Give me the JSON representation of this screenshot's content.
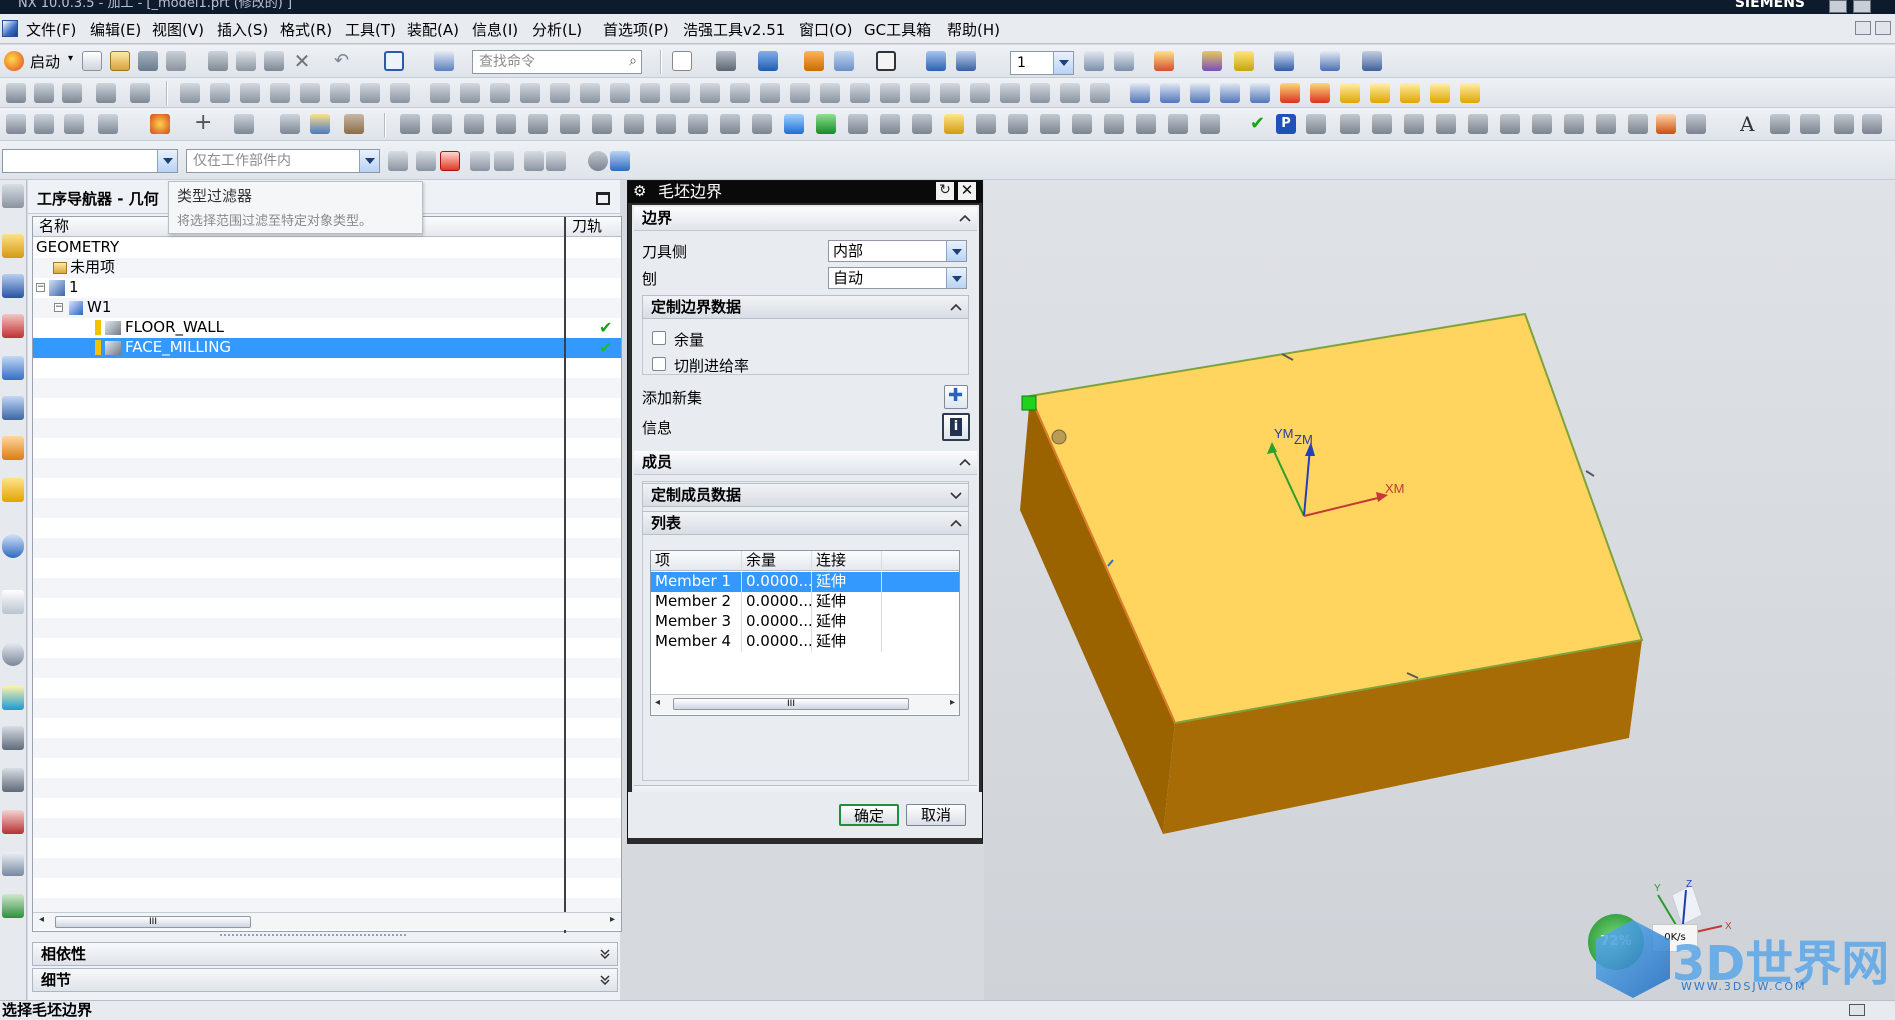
{
  "window": {
    "title": "NX 10.0.3.5 - 加工 - [_model1.prt  (修改的) ]",
    "brand": "SIEMENS"
  },
  "menu": [
    "文件(F)",
    "编辑(E)",
    "视图(V)",
    "插入(S)",
    "格式(R)",
    "工具(T)",
    "装配(A)",
    "信息(I)",
    "分析(L)",
    "首选项(P)",
    "浩强工具v2.51",
    "窗口(O)",
    "GC工具箱",
    "帮助(H)"
  ],
  "toolbar": {
    "start_label": "启动",
    "search_placeholder": "查找命令",
    "layer_value": "1",
    "filter_placeholder": "仅在工作部件内"
  },
  "tooltip": {
    "title": "类型过滤器",
    "text": "将选择范围过滤至特定对象类型。"
  },
  "navigator": {
    "title": "工序导航器 - 几何",
    "columns": {
      "name": "名称",
      "path": "刀轨"
    },
    "rows": [
      {
        "label": "GEOMETRY"
      },
      {
        "label": "未用项"
      },
      {
        "label": "1"
      },
      {
        "label": "W1"
      },
      {
        "label": "FLOOR_WALL",
        "status": "✔"
      },
      {
        "label": "FACE_MILLING",
        "status": "✔"
      }
    ],
    "scroll_thumb": "III",
    "panels": {
      "dependencies": "相依性",
      "details": "细节"
    }
  },
  "dialog": {
    "title": "毛坯边界",
    "boundary": {
      "header": "边界",
      "tool_side_label": "刀具侧",
      "tool_side_value": "内部",
      "plane_label": "刨",
      "plane_value": "自动"
    },
    "custom_boundary": {
      "header": "定制边界数据",
      "stock_label": "余量",
      "feed_label": "切削进给率"
    },
    "add_new_set": "添加新集",
    "info": "信息",
    "members": {
      "header": "成员",
      "custom_header": "定制成员数据",
      "list_header": "列表",
      "columns": [
        "项",
        "余量",
        "连接"
      ],
      "rows": [
        {
          "item": "Member 1",
          "stock": "0.0000...",
          "link": "延伸"
        },
        {
          "item": "Member 2",
          "stock": "0.0000...",
          "link": "延伸"
        },
        {
          "item": "Member 3",
          "stock": "0.0000...",
          "link": "延伸"
        },
        {
          "item": "Member 4",
          "stock": "0.0000...",
          "link": "延伸"
        }
      ],
      "scroll_thumb": "III"
    },
    "ok": "确定",
    "cancel": "取消"
  },
  "viewport": {
    "axes": {
      "ym": "YM",
      "zm": "ZM",
      "xm": "XM"
    },
    "triad": {
      "x": "X",
      "y": "Y",
      "z": "Z"
    },
    "colors": {
      "top": "#ffd45f",
      "side_dark": "#9a6300",
      "side_light": "#c98a12"
    }
  },
  "watermark": {
    "brand": "3D世界网",
    "url": "WWW.3DSJW.COM",
    "badge": "72%",
    "rate": "0K/s"
  },
  "status": {
    "prompt": "选择毛坯边界"
  }
}
